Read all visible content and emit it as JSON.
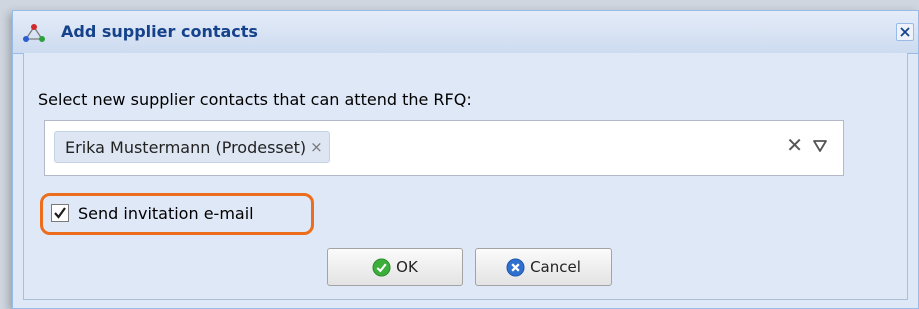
{
  "dialog": {
    "title": "Add supplier contacts",
    "prompt": "Select new supplier contacts that can attend the RFQ:",
    "selected_contacts": [
      {
        "label": "Erika Mustermann (Prodesset)",
        "remove_glyph": "×"
      }
    ],
    "clear_glyph": "✕",
    "send_invitation": {
      "label": "Send invitation e-mail",
      "checked": true
    },
    "buttons": {
      "ok": "OK",
      "cancel": "Cancel"
    }
  },
  "icons": {
    "app": "network-nodes-icon",
    "close": "close-icon",
    "tag_remove": "remove-x-icon",
    "clear": "clear-x-icon",
    "dropdown": "dropdown-triangle-icon",
    "ok": "green-check-circle-icon",
    "cancel": "blue-x-circle-icon"
  },
  "colors": {
    "title_text": "#15428b",
    "dialog_bg": "#dfe8f6",
    "highlight_outline": "#ec6d1b",
    "ok_icon": "#3cae3c",
    "cancel_icon": "#2f6fcf"
  }
}
